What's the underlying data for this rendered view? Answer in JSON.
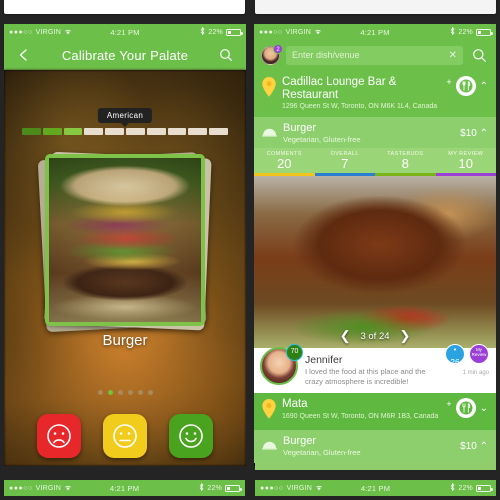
{
  "theme": {
    "green": "#6cc04a",
    "green_light": "#8ccf6c",
    "green_pale": "#9ad677",
    "purple": "#9b3fd6",
    "blue": "#2aa3e0"
  },
  "status_bar": {
    "carrier": "VIRGIN",
    "signal_dots": "●●●○○",
    "time": "4:21 PM",
    "battery": "22%",
    "wifi_icon": "wifi-icon",
    "bluetooth_icon": "bluetooth-icon"
  },
  "left_screen": {
    "nav": {
      "back_icon": "back-arrow-icon",
      "title": "Calibrate Your Palate",
      "search_icon": "search-icon"
    },
    "tooltip": "American",
    "segments": {
      "total": 10,
      "filled": 3
    },
    "card_label": "Burger",
    "pager": {
      "total": 6,
      "active_index": 1
    },
    "rating_buttons": [
      {
        "name": "sad-face-button",
        "mood": "sad",
        "color": "#e8272a"
      },
      {
        "name": "neutral-face-button",
        "mood": "neutral",
        "color": "#f2cc1c"
      },
      {
        "name": "happy-face-button",
        "mood": "happy",
        "color": "#4aa31f"
      }
    ]
  },
  "right_screen": {
    "nav": {
      "avatar_badge": "2",
      "search_placeholder": "Enter dish/venue",
      "clear_icon": "close-icon",
      "search_icon": "search-icon"
    },
    "venue": {
      "name": "Cadillac Lounge Bar & Restaurant",
      "address": "1296 Queen St W, Toronto, ON M6K 1L4, Canada",
      "add_label": "+",
      "logo_icon": "fork-knife-logo-icon",
      "chevron": "⌃"
    },
    "dish": {
      "name": "Burger",
      "tags": "Vegetarian, Gluten-free",
      "price": "$10",
      "chevron": "⌃",
      "icon": "dish-cloche-icon"
    },
    "stats": [
      {
        "label": "COMMENTS",
        "value": "20",
        "color": "#f0c419"
      },
      {
        "label": "OVERALL",
        "value": "7",
        "color": "#2a7fd4"
      },
      {
        "label": "TASTEBUDS",
        "value": "8",
        "color": "#7ab317"
      },
      {
        "label": "MY REVIEW",
        "value": "10",
        "color": "#9b3fd6"
      }
    ],
    "hero": {
      "prev_icon": "chevron-left-icon",
      "counter": "3 of 24",
      "next_icon": "chevron-right-icon"
    },
    "review": {
      "author": "Jennifer",
      "score": "70",
      "text": "I loved the food at this place and the crazy atmosphere is incredible!",
      "time": "1 min ago",
      "likes": {
        "icon": "heart-icon",
        "value": "26"
      },
      "my_review": {
        "label": "My Review",
        "value": "10"
      }
    },
    "venue2": {
      "name": "Mata",
      "address": "1690 Queen St W, Toronto, ON M6R 1B3, Canada",
      "add_label": "+",
      "logo_icon": "fork-knife-logo-icon",
      "chevron": "⌄"
    },
    "dish2": {
      "name": "Burger",
      "tags": "Vegetarian, Gluten-free",
      "price": "$10",
      "chevron": "⌃",
      "icon": "dish-cloche-icon"
    }
  }
}
